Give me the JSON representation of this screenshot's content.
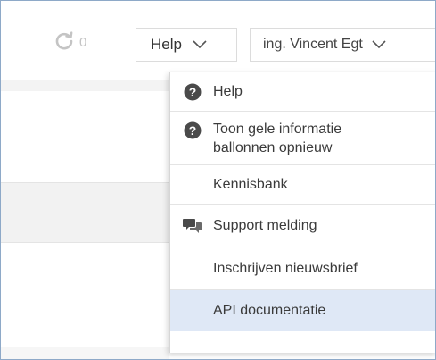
{
  "header": {
    "sync_count": "0",
    "help_label": "Help",
    "user_label": "ing. Vincent Egt"
  },
  "menu": {
    "items": [
      {
        "label": "Help",
        "icon": "question-circle-icon"
      },
      {
        "label_line1": "Toon gele informatie",
        "label_line2": "ballonnen opnieuw",
        "icon": "question-circle-icon"
      },
      {
        "label": "Kennisbank",
        "icon": ""
      },
      {
        "label": "Support melding",
        "icon": "chat-bubbles-icon"
      },
      {
        "label": "Inschrijven nieuwsbrief",
        "icon": ""
      },
      {
        "label": "API documentatie",
        "icon": "",
        "selected": true
      }
    ]
  },
  "colors": {
    "selected_bg": "#dfe8f6",
    "icon_dark": "#4a4a4a",
    "sync_grey": "#c4c4c4",
    "frame_border": "#8ea9c8"
  }
}
